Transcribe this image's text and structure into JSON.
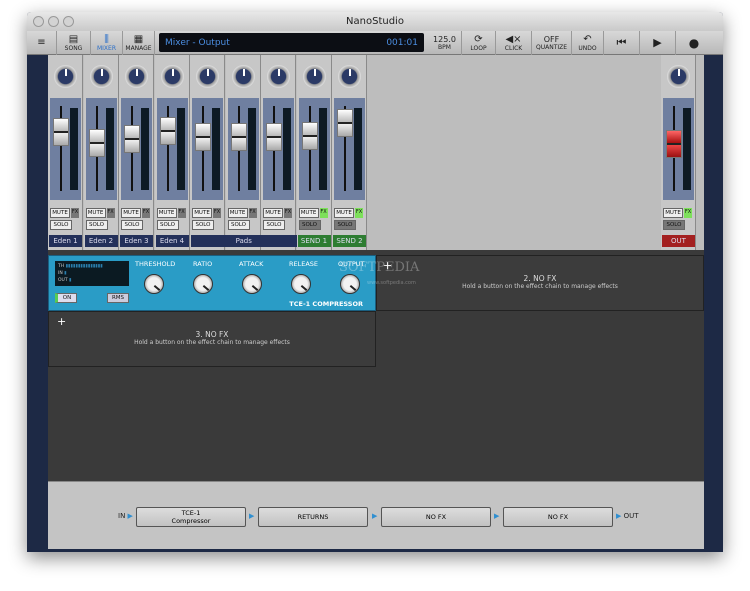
{
  "window": {
    "title": "NanoStudio"
  },
  "toolbar": {
    "song": "SONG",
    "mixer": "MIXER",
    "manage": "MANAGE",
    "display_text": "Mixer - Output",
    "position": "001:01",
    "bpm_value": "125.0",
    "bpm": "BPM",
    "loop": "LOOP",
    "click": "CLICK",
    "quantize_value": "OFF",
    "quantize": "QUANTIZE",
    "undo": "UNDO"
  },
  "mixer": {
    "channels": [
      {
        "name": "Eden 1",
        "fader": 0.8
      },
      {
        "name": "Eden 2",
        "fader": 0.62
      },
      {
        "name": "Eden 3",
        "fader": 0.68
      },
      {
        "name": "Eden 4",
        "fader": 0.82
      },
      {
        "name": "",
        "fader": 0.72
      },
      {
        "name": "",
        "fader": 0.72
      },
      {
        "name": "",
        "fader": 0.72
      },
      {
        "name": "SEND 1",
        "fader": 0.74
      },
      {
        "name": "SEND 2",
        "fader": 0.95
      }
    ],
    "group_label": "Pads",
    "mute": "MUTE",
    "solo": "SOLO",
    "fx": "FX",
    "out_label": "OUT",
    "colors": {
      "track": "#23305a",
      "send": "#2e7d32",
      "out": "#a32020",
      "fx_on": "#7de05a"
    }
  },
  "compressor": {
    "meter_labels": [
      "TH",
      "IN",
      "OUT"
    ],
    "knobs": [
      "THRESHOLD",
      "RATIO",
      "ATTACK",
      "RELEASE",
      "OUTPUT"
    ],
    "on": "ON",
    "rms": "RMS",
    "title": "TCE-1 COMPRESSOR"
  },
  "slots": [
    {
      "title": "2. NO FX",
      "hint": "Hold a button on the effect chain to manage effects"
    },
    {
      "title": "3. NO FX",
      "hint": "Hold a button on the effect chain to manage effects"
    }
  ],
  "watermark": {
    "text": "SOFTPEDIA",
    "url": "www.softpedia.com"
  },
  "chain": {
    "in": "IN",
    "out": "OUT",
    "items": [
      {
        "label": "TCE-1",
        "sub": "Compressor"
      },
      {
        "label": "RETURNS"
      },
      {
        "label": "NO FX"
      },
      {
        "label": "NO FX"
      }
    ]
  }
}
